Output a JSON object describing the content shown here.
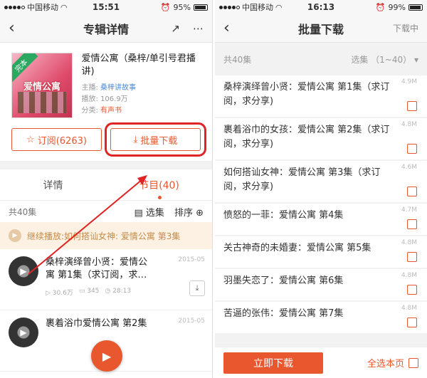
{
  "left": {
    "status": {
      "carrier": "中国移动",
      "time": "15:51",
      "battery": "95%"
    },
    "nav": {
      "title": "专辑详情"
    },
    "album": {
      "cover_tag": "完本",
      "cover_title": "爱情公寓",
      "name": "爱情公寓（桑梓/单引号君播讲)",
      "host_label": "主播:",
      "host": "桑梓讲故事",
      "plays_label": "播放:",
      "plays": "106.9万",
      "category_label": "分类:",
      "category": "有声书"
    },
    "subscribe_label": "订阅(6263)",
    "batch_label": "批量下载",
    "tabs": [
      "详情",
      "节目(40)"
    ],
    "list_count": "共40集",
    "select_label": "选集",
    "sort_label": "排序",
    "continue_text": "继续播放:如何搭讪女神:  爱情公寓  第3集",
    "tracks": [
      {
        "name": "桑梓演绎曾小贤：爱情公寓 第1集（求订阅，求…",
        "date": "2015-05",
        "plays": "30.6万",
        "comments": "345",
        "duration": "28:13"
      },
      {
        "name": "裹着浴巾爱情公寓 第2集",
        "date": "2015-05"
      }
    ]
  },
  "right": {
    "status": {
      "carrier": "中国移动",
      "time": "16:13",
      "battery": "99%"
    },
    "nav": {
      "title": "批量下载",
      "action": "下载中"
    },
    "count": "共40集",
    "select_label": "选集 （1~40）",
    "episodes": [
      {
        "name": "桑梓演绎曾小贤：爱情公寓 第1集（求订阅，求分享)",
        "size": "4.9M"
      },
      {
        "name": "裹着浴巾的女孩：爱情公寓 第2集（求订阅，求分享)",
        "size": "4.8M"
      },
      {
        "name": "如何搭讪女神：爱情公寓 第3集（求订阅，求分享)",
        "size": "4.6M"
      },
      {
        "name": "愤怒的一菲：爱情公寓 第4集",
        "size": "4.7M"
      },
      {
        "name": "关古神奇的未婚妻：爱情公寓 第5集",
        "size": "4.8M"
      },
      {
        "name": "羽墨失恋了：爱情公寓 第6集",
        "size": "4.8M"
      },
      {
        "name": "苦逼的张伟：爱情公寓 第7集",
        "size": "4.8M"
      }
    ],
    "download_now": "立即下载",
    "select_all": "全选本页"
  }
}
